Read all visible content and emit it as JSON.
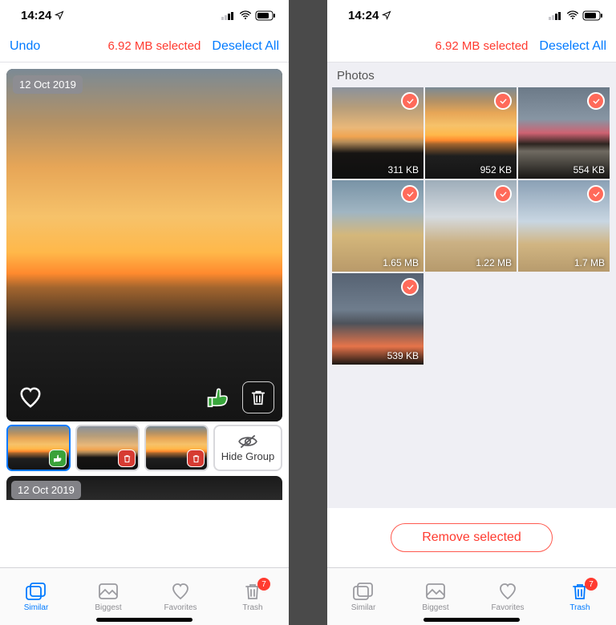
{
  "status": {
    "time": "14:24"
  },
  "left": {
    "nav": {
      "undo": "Undo",
      "selected": "6.92 MB selected",
      "deselect": "Deselect All"
    },
    "date": "12 Oct 2019",
    "hide_group": "Hide Group",
    "peek_date": "12 Oct 2019",
    "tabs": {
      "similar": "Similar",
      "biggest": "Biggest",
      "favorites": "Favorites",
      "trash": "Trash",
      "trash_badge": "7"
    }
  },
  "right": {
    "nav": {
      "selected": "6.92 MB selected",
      "deselect": "Deselect All"
    },
    "section": "Photos",
    "cells": [
      {
        "size": "311 KB"
      },
      {
        "size": "952 KB"
      },
      {
        "size": "554 KB"
      },
      {
        "size": "1.65 MB"
      },
      {
        "size": "1.22 MB"
      },
      {
        "size": "1.7 MB"
      },
      {
        "size": "539 KB"
      }
    ],
    "remove": "Remove selected",
    "tabs": {
      "similar": "Similar",
      "biggest": "Biggest",
      "favorites": "Favorites",
      "trash": "Trash",
      "trash_badge": "7"
    }
  }
}
